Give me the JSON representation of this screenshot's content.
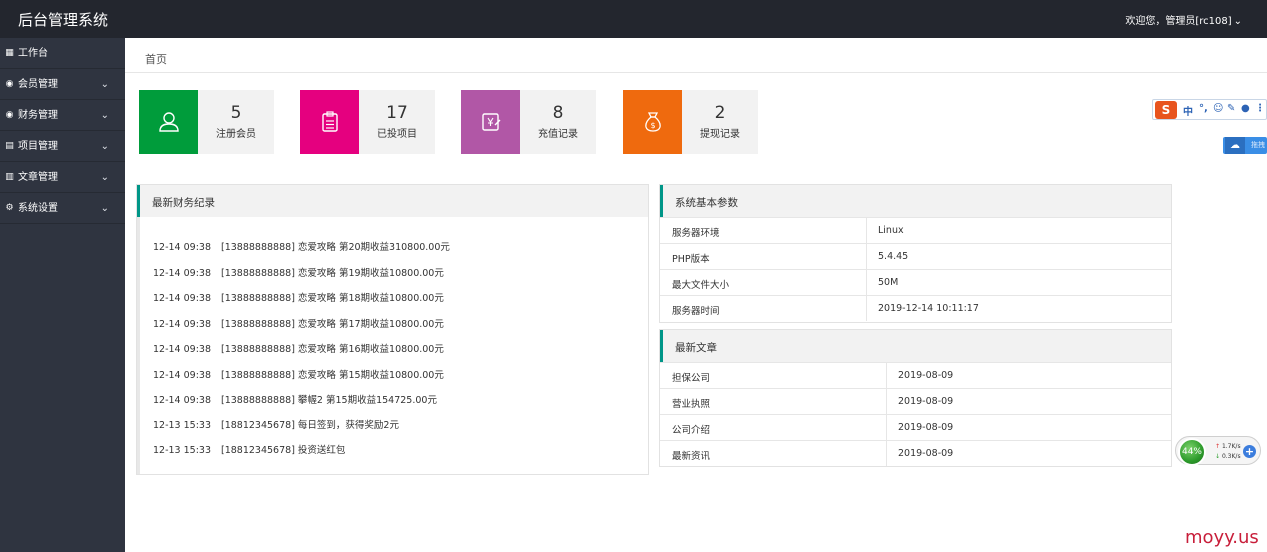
{
  "header": {
    "title": "后台管理系统",
    "user_label": "欢迎您，管理员[rc108]"
  },
  "sidebar": {
    "items": [
      {
        "label": "工作台",
        "icon": "dashboard-icon",
        "has_submenu": false
      },
      {
        "label": "会员管理",
        "icon": "user-icon",
        "has_submenu": true
      },
      {
        "label": "财务管理",
        "icon": "finance-icon",
        "has_submenu": true
      },
      {
        "label": "项目管理",
        "icon": "project-icon",
        "has_submenu": true
      },
      {
        "label": "文章管理",
        "icon": "article-icon",
        "has_submenu": true
      },
      {
        "label": "系统设置",
        "icon": "gear-icon",
        "has_submenu": true
      }
    ]
  },
  "breadcrumb": {
    "current": "首页"
  },
  "stats": [
    {
      "value": "5",
      "label": "注册会员",
      "color": "#009c3b",
      "icon": "user-icon"
    },
    {
      "value": "17",
      "label": "已投项目",
      "color": "#e5007f",
      "icon": "clipboard-icon"
    },
    {
      "value": "8",
      "label": "充值记录",
      "color": "#b157a6",
      "icon": "recharge-icon"
    },
    {
      "value": "2",
      "label": "提现记录",
      "color": "#ef6a0e",
      "icon": "money-bag-icon"
    }
  ],
  "finance_panel": {
    "title": "最新财务纪录",
    "items": [
      {
        "time": "12-14 09:38",
        "text": "[13888888888] 恋爱攻略 第20期收益310800.00元"
      },
      {
        "time": "12-14 09:38",
        "text": "[13888888888] 恋爱攻略 第19期收益10800.00元"
      },
      {
        "time": "12-14 09:38",
        "text": "[13888888888] 恋爱攻略 第18期收益10800.00元"
      },
      {
        "time": "12-14 09:38",
        "text": "[13888888888] 恋爱攻略 第17期收益10800.00元"
      },
      {
        "time": "12-14 09:38",
        "text": "[13888888888] 恋爱攻略 第16期收益10800.00元"
      },
      {
        "time": "12-14 09:38",
        "text": "[13888888888] 恋爱攻略 第15期收益10800.00元"
      },
      {
        "time": "12-14 09:38",
        "text": "[13888888888] 攀幄2 第15期收益154725.00元"
      },
      {
        "time": "12-13 15:33",
        "text": "[18812345678] 每日签到，获得奖励2元"
      },
      {
        "time": "12-13 15:33",
        "text": "[18812345678] 投资送红包"
      }
    ]
  },
  "system_panel": {
    "title": "系统基本参数",
    "rows": [
      {
        "key": "服务器环境",
        "value": "Linux"
      },
      {
        "key": "PHP版本",
        "value": "5.4.45"
      },
      {
        "key": "最大文件大小",
        "value": "50M"
      },
      {
        "key": "服务器时间",
        "value": "2019-12-14 10:11:17"
      }
    ]
  },
  "articles_panel": {
    "title": "最新文章",
    "rows": [
      {
        "key": "担保公司",
        "value": "2019-08-09"
      },
      {
        "key": "营业执照",
        "value": "2019-08-09"
      },
      {
        "key": "公司介绍",
        "value": "2019-08-09"
      },
      {
        "key": "最新资讯",
        "value": "2019-08-09"
      }
    ]
  },
  "overlays": {
    "ime_logo": "S",
    "ime_mode": "中",
    "cloud_label": "拖拽",
    "net_percent": "44%",
    "net_up": "1.7K/s",
    "net_down": "0.3K/s",
    "net_plus": "+"
  },
  "watermark": "moyy.us"
}
